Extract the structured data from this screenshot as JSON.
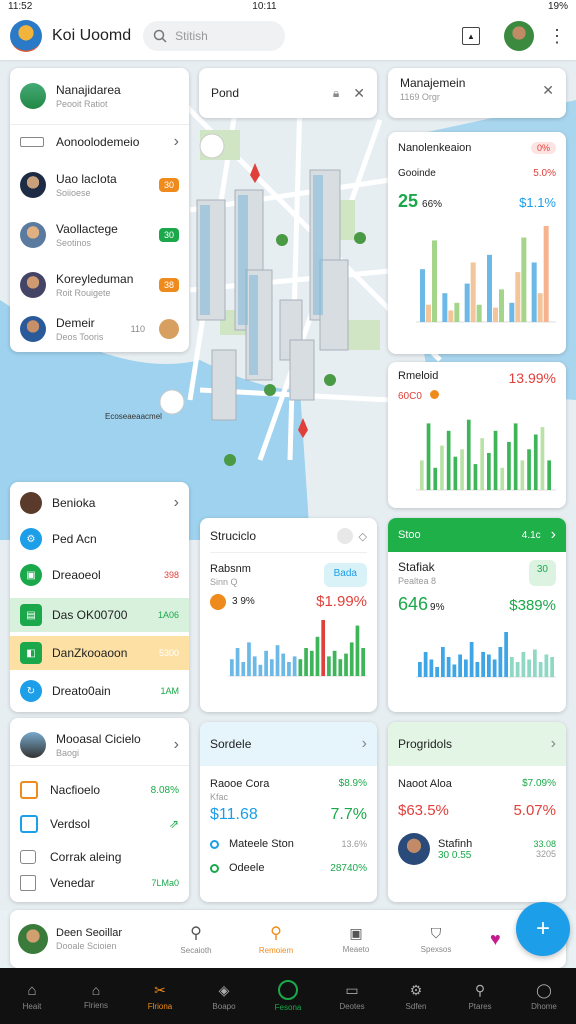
{
  "status": {
    "time": "11:52",
    "center": "10:11",
    "battery": "19%"
  },
  "header": {
    "title": "Koi Uoomd",
    "search_placeholder": "Stitish"
  },
  "map": {
    "label": "Ecoseaeaacmel"
  },
  "contacts": {
    "items": [
      {
        "name": "Nanajidarea",
        "sub": "Peooit Ratiot",
        "badge": ""
      },
      {
        "name": "Aonoolodemeio",
        "sub": "",
        "badge": ""
      },
      {
        "name": "Uao lacIota",
        "sub": "Soiioese",
        "badge": "30"
      },
      {
        "name": "Vaollactege",
        "sub": "Seotinos",
        "badge": "30"
      },
      {
        "name": "Koreyleduman",
        "sub": "Roit Rouigete",
        "badge": "38"
      },
      {
        "name": "Demeir",
        "sub": "Deos Tooris",
        "badge": "110"
      }
    ]
  },
  "pond": {
    "title": "Pond"
  },
  "manage": {
    "title": "Manajemein",
    "sub": "1169 Orgr"
  },
  "chart1": {
    "title": "Nanolenkeaion",
    "tag": "0%",
    "label": "Gooinde",
    "pct": "5.0%",
    "big": "25",
    "big_pct": "66%",
    "value": "$1.1%"
  },
  "chart2": {
    "title": "Rmeloid",
    "sub": "60C0",
    "value": "13.99%"
  },
  "leftlist": {
    "items": [
      {
        "name": "Benioka",
        "value": ""
      },
      {
        "name": "Ped Acn",
        "value": ""
      },
      {
        "name": "Dreaoeol",
        "value": "398"
      },
      {
        "name": "Das OK00700",
        "value": "1A06"
      },
      {
        "name": "DanZkooaoon",
        "value": "5300"
      },
      {
        "name": "Dreato0ain",
        "value": "1AM"
      }
    ]
  },
  "leftlist2": {
    "title": "Mooasal Cicielo",
    "sub": "Baogi",
    "items": [
      {
        "name": "Nacfioelo",
        "value": "8.08%"
      },
      {
        "name": "Verdsol",
        "value": ""
      },
      {
        "name": "Corrak aleing",
        "value": ""
      },
      {
        "name": "Venedar",
        "value": "7LMa0"
      }
    ]
  },
  "studio": {
    "title": "Struciclo",
    "label": "Rabsnm",
    "sub": "Sinn Q",
    "badge": "Bada",
    "pct": "3 9%",
    "value": "$1.99%"
  },
  "stat": {
    "header": "Stoo",
    "header_num": "4.1c",
    "title": "Stafiak",
    "sub": "Pealtea 8",
    "badge": "30",
    "big": "646",
    "big_pct": "9%",
    "value": "$389%"
  },
  "sordele": {
    "title": "Sordele",
    "r1_label": "Raooe Cora",
    "r1_pct": "$8.9%",
    "r1_sub": "Kfac",
    "r1_value": "$11.68",
    "r1_right": "7.7%",
    "r2_label": "Mateele Ston",
    "r2_right": "13.6%",
    "r3_label": "Odeele",
    "r3_right": "28740%"
  },
  "progress": {
    "title": "Progridols",
    "label": "Naoot Aloa",
    "pct": "$7.09%",
    "value_left": "$63.5%",
    "value_right": "5.07%",
    "person": "Stafinh",
    "person_val": "30 0.55",
    "person_sub": "3205",
    "person_right": "33.08"
  },
  "profile": {
    "name": "Deen Seoillar",
    "sub": "Dooale Scioien"
  },
  "actions": [
    "Secaioth",
    "Remoiem",
    "Meaeto",
    "Spexsos"
  ],
  "fab": "+",
  "tabs": [
    "Heait",
    "Flriens",
    "Flriona",
    "Boapo",
    "Fesona",
    "Deotes",
    "Sdfen",
    "Ptares",
    "Dhome"
  ],
  "colors": {
    "green": "#1aa84a",
    "red": "#e0403a",
    "orange": "#ef8b1c",
    "blue": "#1c9ee8"
  },
  "chart_bars1": [
    [
      0.55,
      0.18,
      0.85
    ],
    [
      0.3,
      0.12,
      0.2
    ],
    [
      0.4,
      0.62,
      0.18
    ],
    [
      0.7,
      0.15,
      0.34
    ],
    [
      0.2,
      0.52,
      0.88
    ],
    [
      0.62,
      0.3,
      1.0
    ]
  ],
  "chart_bars2": [
    0.4,
    0.9,
    0.3,
    0.6,
    0.8,
    0.45,
    0.55,
    0.95,
    0.35,
    0.7,
    0.5,
    0.8,
    0.3,
    0.65,
    0.9,
    0.4,
    0.55,
    0.75,
    0.85,
    0.4
  ],
  "chart_bars3": [
    0.3,
    0.5,
    0.25,
    0.6,
    0.35,
    0.2,
    0.45,
    0.3,
    0.55,
    0.4,
    0.25,
    0.35,
    0.3,
    0.5,
    0.45,
    0.7,
    1.0,
    0.35,
    0.45,
    0.3,
    0.4,
    0.6,
    0.9,
    0.5
  ],
  "chart_bars4": [
    0.3,
    0.5,
    0.35,
    0.2,
    0.6,
    0.4,
    0.25,
    0.45,
    0.35,
    0.7,
    0.3,
    0.5,
    0.45,
    0.35,
    0.6,
    0.9,
    0.4,
    0.3,
    0.5,
    0.35,
    0.55,
    0.3,
    0.45,
    0.4
  ]
}
